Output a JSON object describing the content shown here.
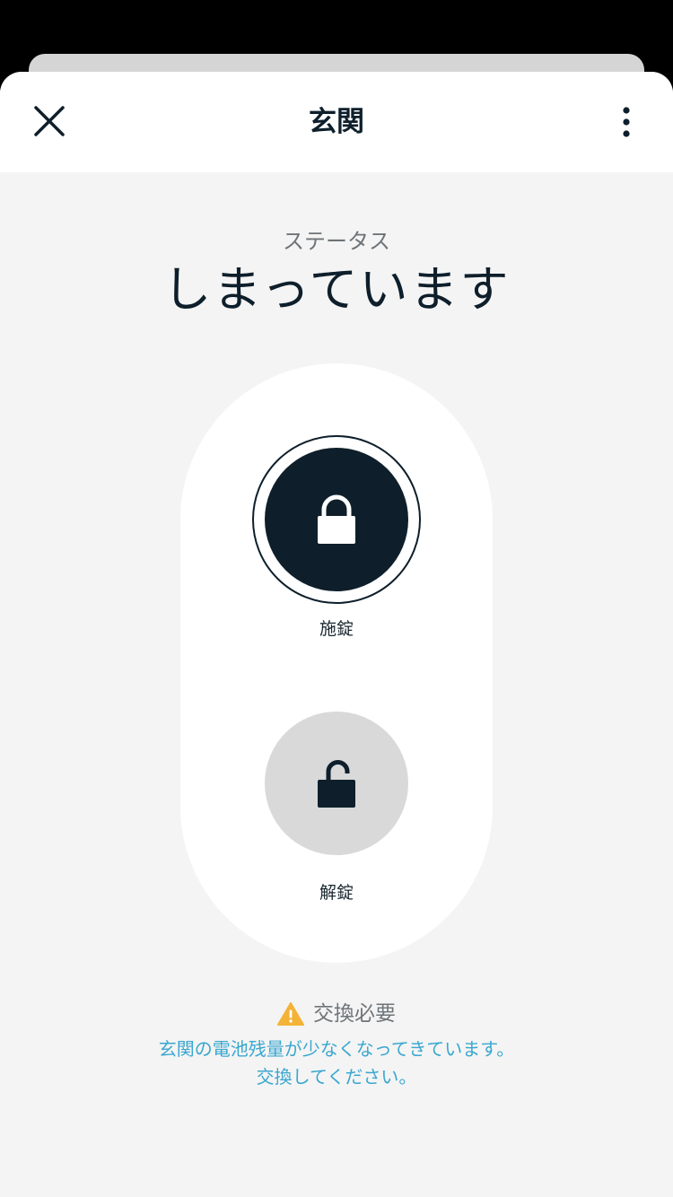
{
  "header": {
    "title": "玄関",
    "close_icon": "close-icon",
    "more_icon": "more-vertical-icon"
  },
  "status": {
    "label": "ステータス",
    "value": "しまっています"
  },
  "controls": {
    "lock": {
      "label": "施錠",
      "icon": "lock-closed-icon",
      "selected": true
    },
    "unlock": {
      "label": "解錠",
      "icon": "lock-open-icon",
      "selected": false
    }
  },
  "warning": {
    "icon": "warning-icon",
    "title": "交換必要",
    "message_line1": "玄関の電池残量が少なくなってきています。",
    "message_line2": "交換してください。"
  },
  "colors": {
    "dark": "#0e1f2b",
    "background": "#f4f4f4",
    "unlock_button": "#d9d9d9",
    "warning": "#f4b236",
    "link": "#3aa7cf"
  }
}
